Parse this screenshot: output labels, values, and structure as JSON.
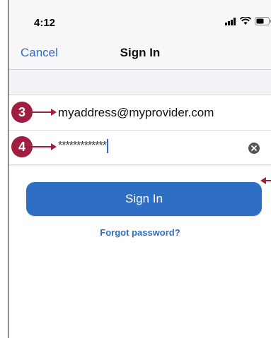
{
  "status_bar": {
    "time": "4:12",
    "icons": [
      "signal-icon",
      "wifi-icon",
      "battery-icon"
    ]
  },
  "nav": {
    "cancel_label": "Cancel",
    "title": "Sign In"
  },
  "form": {
    "email_value": "myaddress@myprovider.com",
    "password_value": "*************"
  },
  "actions": {
    "signin_label": "Sign In",
    "forgot_label": "Forgot password?"
  },
  "callouts": {
    "step_3": "3",
    "step_4": "4"
  },
  "colors": {
    "accent": "#2e6fc5",
    "callout": "#a01f3f"
  }
}
